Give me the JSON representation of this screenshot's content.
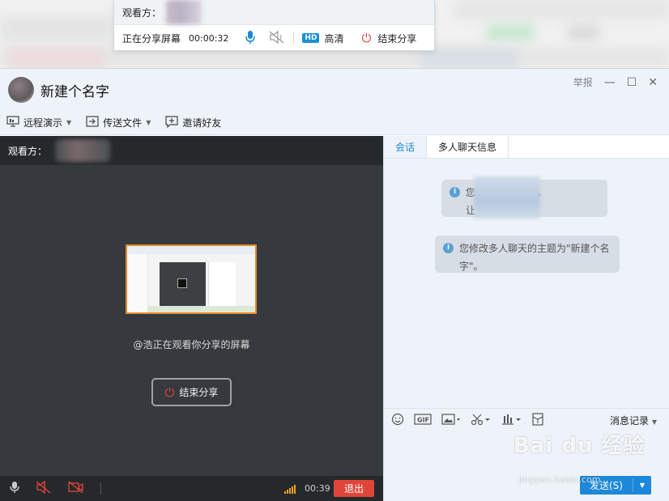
{
  "share_toolbar": {
    "viewers_label": "观看方：",
    "status": "正在分享屏幕",
    "timer": "00:00:32",
    "hd_badge": "HD",
    "quality_label": "高清",
    "end_label": "结束分享"
  },
  "window": {
    "title": "新建个名字",
    "report": "举报",
    "minimize": "—",
    "maximize": "☐",
    "close": "✕"
  },
  "toolbar": {
    "remote_demo": "远程演示",
    "send_file": "传送文件",
    "invite": "邀请好友"
  },
  "share_panel": {
    "viewers_label": "观看方：",
    "watching_text": "@浩正在观看你分享的屏幕",
    "end_button": "结束分享",
    "call_time": "00:39",
    "exit_button": "退出"
  },
  "chat": {
    "tabs": [
      "会话",
      "多人聊天信息"
    ],
    "system_messages": [
      {
        "line1": "您邀        入多人聊天。",
        "line2": "让         沟通更便捷。"
      },
      {
        "line1": "您修改多人聊天的主题为\"新建个名",
        "line2": "字\"。"
      }
    ],
    "history_label": "消息记录",
    "send_label": "发送(S)"
  },
  "watermark": {
    "logo": "Bai du 经验",
    "url": "jingyan.baidu.com"
  }
}
